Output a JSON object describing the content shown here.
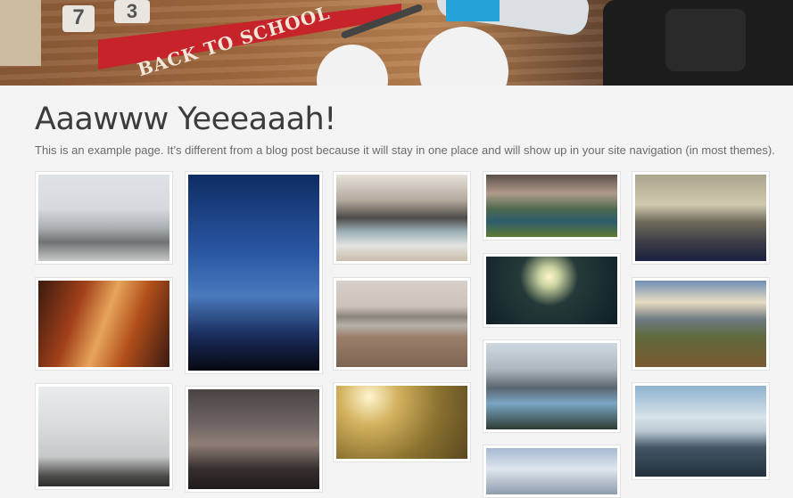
{
  "hero": {
    "pennant_text": "BACK TO SCHOOL",
    "tile_1": "7",
    "tile_2": "3"
  },
  "page": {
    "title": "Aaawww Yeeeaaah!",
    "description": "This is an example page. It’s different from a blog post because it will stay in one place and will show up in your site navigation (in most themes)."
  },
  "gallery": {
    "images": [
      {
        "name": "snowy-mountain-birds"
      },
      {
        "name": "milky-way-night-sky"
      },
      {
        "name": "rocky-shore-waves"
      },
      {
        "name": "green-valley-river"
      },
      {
        "name": "misty-mountain-peak"
      },
      {
        "name": "antelope-canyon"
      },
      {
        "name": "lake-and-grass"
      },
      {
        "name": "sunlit-forest-road"
      },
      {
        "name": "mountain-ridge-clouds"
      },
      {
        "name": "foggy-rock"
      },
      {
        "name": "misty-bridge-statues"
      },
      {
        "name": "sunny-meadow-tree"
      },
      {
        "name": "mountain-lake"
      },
      {
        "name": "coastal-mountains-sky"
      },
      {
        "name": "snowy-peaks"
      }
    ]
  }
}
